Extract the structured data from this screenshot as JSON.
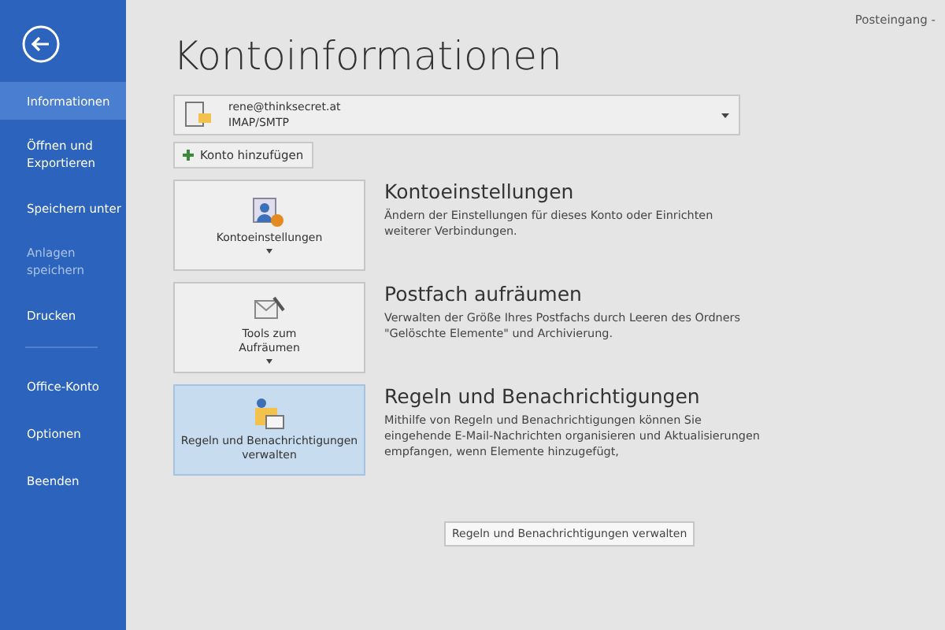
{
  "nav": {
    "items": [
      {
        "label": "Informationen",
        "selected": true,
        "disabled": false,
        "kind": "item"
      },
      {
        "label": "Öffnen und Exportieren",
        "selected": false,
        "disabled": false,
        "kind": "item"
      },
      {
        "label": "Speichern unter",
        "selected": false,
        "disabled": false,
        "kind": "item"
      },
      {
        "label": "Anlagen speichern",
        "selected": false,
        "disabled": true,
        "kind": "item"
      },
      {
        "label": "Drucken",
        "selected": false,
        "disabled": false,
        "kind": "item"
      },
      {
        "kind": "divider"
      },
      {
        "label": "Office-Konto",
        "selected": false,
        "disabled": false,
        "kind": "item"
      },
      {
        "label": "Optionen",
        "selected": false,
        "disabled": false,
        "kind": "item"
      },
      {
        "label": "Beenden",
        "selected": false,
        "disabled": false,
        "kind": "item"
      }
    ]
  },
  "header": {
    "folder": "Posteingang -"
  },
  "title": "Kontoinformationen",
  "account": {
    "email": "rene@thinksecret.at",
    "type": "IMAP/SMTP"
  },
  "add_account": "Konto hinzufügen",
  "sections": [
    {
      "button": "Kontoeinstellungen",
      "dropdown": true,
      "kind": "settings",
      "hovered": false,
      "heading": "Kontoeinstellungen",
      "description": "Ändern der Einstellungen für dieses Konto oder Einrichten weiterer Verbindungen."
    },
    {
      "button": "Tools zum Aufräumen",
      "dropdown": true,
      "kind": "cleanup",
      "hovered": false,
      "heading": "Postfach aufräumen",
      "description": "Verwalten der Größe Ihres Postfachs durch Leeren des Ordners \"Gelöschte Elemente\" und Archivierung."
    },
    {
      "button": "Regeln und Benachrichtigungen verwalten",
      "dropdown": false,
      "kind": "rules",
      "hovered": true,
      "heading": "Regeln und Benachrichtigungen",
      "description": "Mithilfe von Regeln und Benachrichtigungen können Sie eingehende E-Mail-Nachrichten organisieren und Aktualisierungen empfangen, wenn Elemente hinzugefügt,"
    }
  ],
  "tooltip": "Regeln und Benachrichtigungen verwalten"
}
